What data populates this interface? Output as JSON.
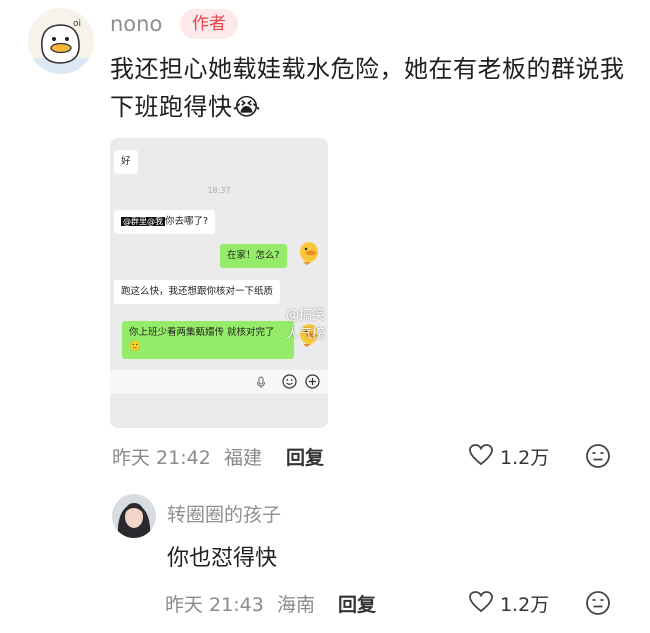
{
  "comment": {
    "username": "nono",
    "badge": "作者",
    "text": "我还担心她载娃载水危险，她在有老板的群说我下班跑得快",
    "emoji": "😭",
    "meta": {
      "time": "昨天 21:42",
      "location": "福建",
      "reply_label": "回复",
      "likes": "1.2万"
    }
  },
  "chat_screenshot": {
    "msg1": "好",
    "timestamp": "18:37",
    "msg2_mention": "@群里@我",
    "msg2_text": "你去哪了?",
    "msg3": "在家！怎么?",
    "msg4": "跑这么快，我还想跟你核对一下纸质",
    "msg5": "你上班少看两集甄嬛传 就核对完了",
    "msg5_emoji": "🙂",
    "watermark": "@搞笑人气榜"
  },
  "reply": {
    "username": "转圈圈的孩子",
    "text": "你也怼得快",
    "meta": {
      "time": "昨天 21:43",
      "location": "海南",
      "reply_label": "回复",
      "likes": "1.2万"
    }
  },
  "colors": {
    "badge_bg": "#fde9ea",
    "badge_text": "#e5454f",
    "wechat_green": "#95ec69"
  }
}
